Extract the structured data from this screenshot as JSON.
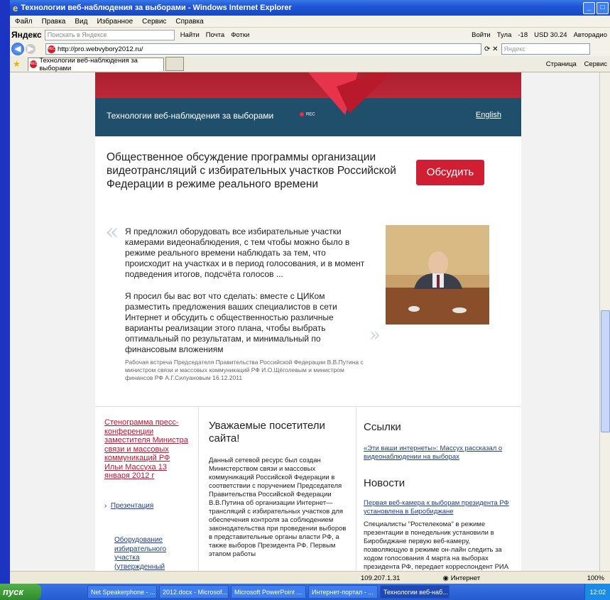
{
  "window": {
    "title": "Технологии веб-наблюдения за выборами - Windows Internet Explorer"
  },
  "menu": [
    "Файл",
    "Правка",
    "Вид",
    "Избранное",
    "Сервис",
    "Справка"
  ],
  "yandex_bar": {
    "brand": "Яндекс",
    "search_placeholder": "Поискать в Яндексе",
    "find": "Найти",
    "mail": "Почта",
    "photos": "Фотки",
    "right_items": [
      "Войти",
      "Тула",
      "-18",
      "USD 30.24",
      "Авторадио"
    ]
  },
  "address": {
    "url": "http://pro.webvybory2012.ru/",
    "search_placeholder": "Яндекс"
  },
  "tab": {
    "label": "Технологии веб-наблюдения за выборами"
  },
  "tools": {
    "page": "Страница",
    "service": "Сервис"
  },
  "site": {
    "name": "Технологии веб-наблюдения за выборами",
    "rec": "REC",
    "english": "English"
  },
  "hero": {
    "headline": "Общественное обсуждение программы организации видеотрансляций с избирательных участков Российской Федерации в режиме реального времени",
    "discuss_button": "Обсудить"
  },
  "quote": {
    "p1": "Я предложил оборудовать все избирательные участки камерами видеонаблюдения, с тем чтобы можно было в режиме реального времени наблюдать за тем, что происходит на участках и в период голосования, и в момент подведения итогов, подсчёта голосов ...",
    "p2": "Я просил бы вас вот что сделать: вместе с ЦИКом разместить предложения ваших специалистов в сети Интернет и обсудить с общественностью различные варианты реализации этого плана, чтобы выбрать оптимальный по результатам, и минимальный по финансовым вложениям",
    "source": "Рабочая встреча Председателя Правительства Российской Федерации В.В.Путина с министром связи и массовых коммуникаций РФ И.О.Щёголевым и министром финансов РФ А.Г.Силуановым 16.12.2011"
  },
  "col1": {
    "transcript": "Стенограмма пресс-конференции заместителя Министра связи и массовых коммуникаций РФ Ильи Массуха 13 января 2012 г",
    "presentation": "Презентация",
    "equipment": "Оборудование избирательного участка (утвержденный вариант)"
  },
  "col2": {
    "heading": "Уважаемые посетители сайта!",
    "body": "Данный сетевой ресурс был создан Министерством связи и массовых коммуникаций Российской Федерации в соответствии с поручением Председателя Правительства Российской Федерации В.В.Путина об организации Интернет—трансляций с избирательных участков для обеспечения контроля за соблюдением законодательства при проведении выборов в представительные органы власти РФ, а также выборов Президента РФ. Первым этапом работы"
  },
  "col3": {
    "links_heading": "Ссылки",
    "link1": "«Эти ваши интернеты»: Массух рассказал о видеонаблюдении на выборах",
    "news_heading": "Новости",
    "news_title": "Первая веб-камера к выборам президента РФ установлена в Биробиджане",
    "news_text": "Специалисты \"Ростелекома\" в режиме презентации в понедельник установили в Биробиджане первую веб-камеру, позволяющую в режиме он-лайн следить за ходом голосования 4 марта на выборах президента РФ, передает корреспондент РИА"
  },
  "status": {
    "ip": "109.207.1.31",
    "zone": "Интернет",
    "zoom": "100%"
  },
  "taskbar": {
    "start": "пуск",
    "tasks": [
      "Net Speakerphone - ...",
      "2012.docx - Microsof...",
      "Microsoft PowerPoint ...",
      "Интернет-портал - ...",
      "Технологии веб-наб..."
    ],
    "clock": "12:02"
  },
  "colors": {
    "accent_red": "#d01f33",
    "header_blue": "#1f4f6b",
    "link_blue": "#1d3f8f"
  }
}
